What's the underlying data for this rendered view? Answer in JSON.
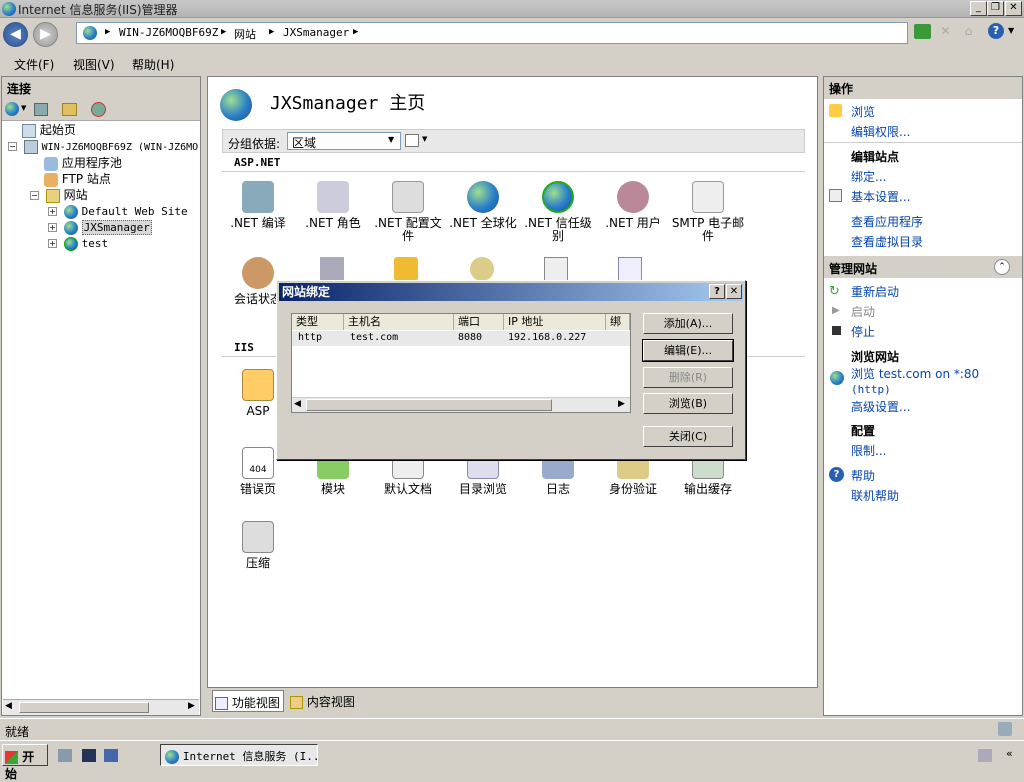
{
  "window": {
    "title": "Internet 信息服务(IIS)管理器"
  },
  "address": {
    "segments": [
      "WIN-JZ6MOQBF69Z",
      "网站",
      "JXSmanager"
    ]
  },
  "menu": {
    "file": "文件(F)",
    "view": "视图(V)",
    "help": "帮助(H)"
  },
  "connections": {
    "header": "连接",
    "tree": {
      "start_page": "起始页",
      "server": "WIN-JZ6MOQBF69Z (WIN-JZ6MO",
      "app_pools": "应用程序池",
      "ftp_sites": "FTP 站点",
      "websites": "网站",
      "sites": [
        "Default Web Site",
        "JXSmanager",
        "test"
      ]
    }
  },
  "main": {
    "title": "JXSmanager 主页",
    "group_by_label": "分组依据:",
    "group_by_value": "区域",
    "section_aspnet": "ASP.NET",
    "section_iis": "IIS",
    "aspnet_features": [
      ".NET 编译",
      ".NET 角色",
      ".NET 配置文件",
      ".NET 全球化",
      ".NET 信任级别",
      ".NET 用户",
      "SMTP 电子邮件"
    ],
    "row2_features": [
      "会话状态"
    ],
    "iis_features": [
      "ASP"
    ],
    "iis_row2": [
      "错误页",
      "模块",
      "默认文档",
      "目录浏览",
      "日志",
      "身份验证",
      "输出缓存"
    ],
    "iis_row3": [
      "压缩"
    ],
    "error_icon_text": "404",
    "tabs": {
      "features": "功能视图",
      "content": "内容视图"
    }
  },
  "actions": {
    "header": "操作",
    "browse": "浏览",
    "edit_permissions": "编辑权限...",
    "edit_site_header": "编辑站点",
    "bindings": "绑定...",
    "basic_settings": "基本设置...",
    "view_apps": "查看应用程序",
    "view_vdirs": "查看虚拟目录",
    "manage_site_header": "管理网站",
    "restart": "重新启动",
    "start": "启动",
    "stop": "停止",
    "browse_site_header": "浏览网站",
    "browse_site": "浏览 test.com on *:80",
    "browse_site_proto": "(http)",
    "advanced_settings": "高级设置...",
    "config_header": "配置",
    "limits": "限制...",
    "help": "帮助",
    "online_help": "联机帮助"
  },
  "dialog": {
    "title": "网站绑定",
    "columns": [
      "类型",
      "主机名",
      "端口",
      "IP 地址",
      "绑定"
    ],
    "rows": [
      {
        "type": "http",
        "host": "test.com",
        "port": "8080",
        "ip": "192.168.0.227"
      }
    ],
    "buttons": {
      "add": "添加(A)...",
      "edit": "编辑(E)...",
      "remove": "删除(R)",
      "browse": "浏览(B)",
      "close": "关闭(C)"
    }
  },
  "status": {
    "text": "就绪"
  },
  "taskbar": {
    "start": "开始",
    "task": "Internet 信息服务 (I..."
  }
}
